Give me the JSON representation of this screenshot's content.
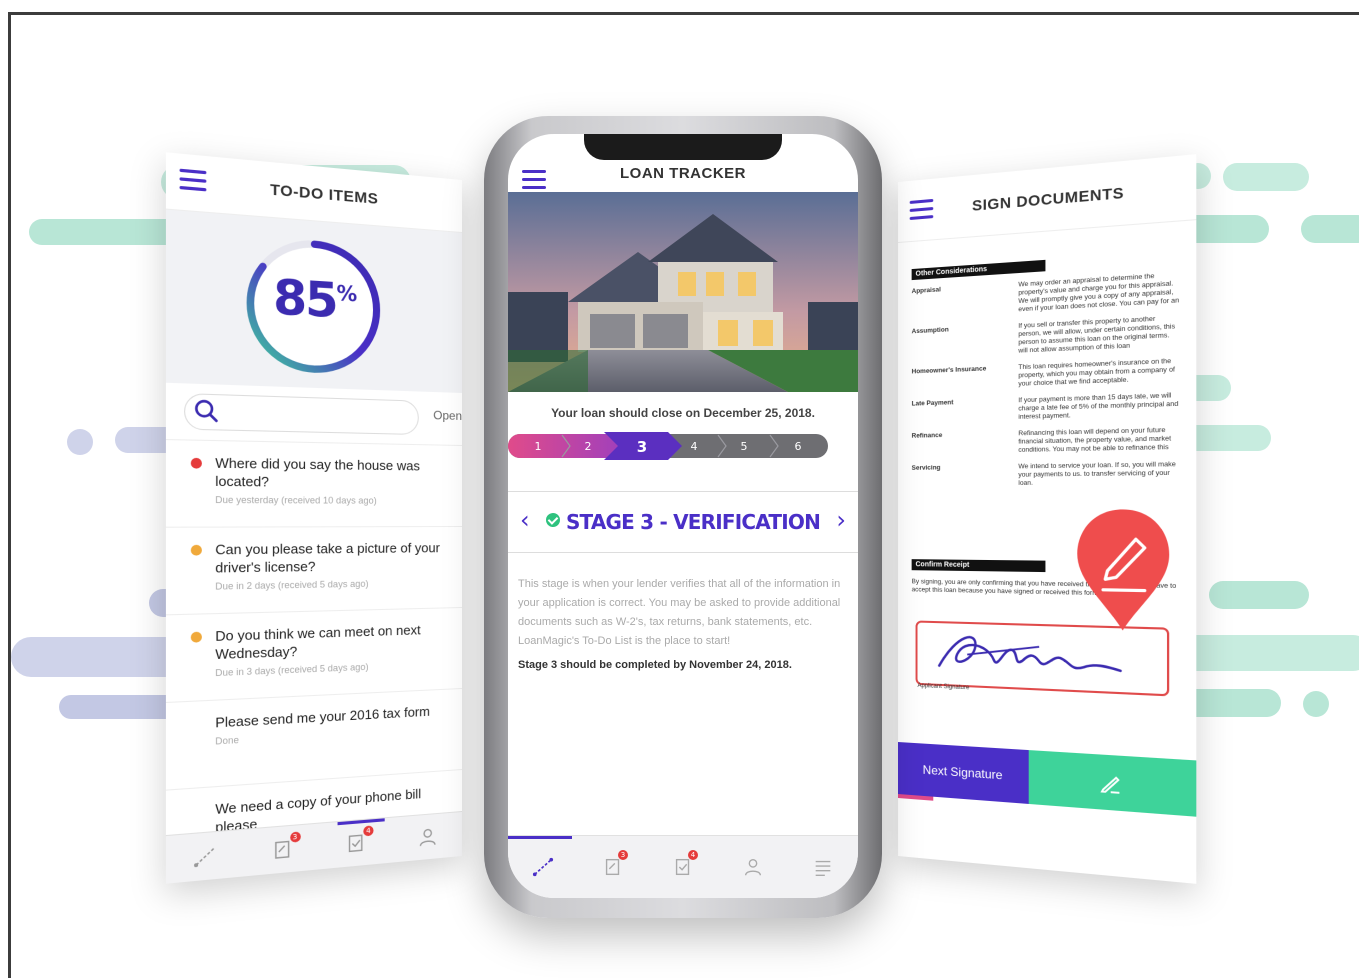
{
  "colors": {
    "accent": "#4a2fc7",
    "green": "#3ed39a",
    "red": "#e53b3b",
    "orange": "#f0a93b"
  },
  "todo_screen": {
    "title": "TO-DO ITEMS",
    "progress_pct": 85,
    "progress_value": "85",
    "progress_unit": "%",
    "search_placeholder": "",
    "tab_open": "Open",
    "items": [
      {
        "text": "Where did you say the house was located?",
        "sub": "Due yesterday (received 10 days ago)",
        "status": "red"
      },
      {
        "text": "Can you please take a picture of your driver's license?",
        "sub": "Due in 2 days (received 5 days ago)",
        "status": "orange"
      },
      {
        "text": "Do you think we can meet on next Wednesday?",
        "sub": "Due in 3 days (received 5 days ago)",
        "status": "orange"
      },
      {
        "text": "Please send me your 2016 tax form",
        "sub": "Done",
        "status": "none"
      },
      {
        "text": "We need a copy of your phone bill please",
        "sub": "",
        "status": "none"
      }
    ],
    "tabs": [
      {
        "icon": "tracker-icon",
        "badge": ""
      },
      {
        "icon": "documents-icon",
        "badge": "3"
      },
      {
        "icon": "todo-icon",
        "badge": "4"
      },
      {
        "icon": "profile-icon",
        "badge": ""
      }
    ]
  },
  "loan_screen": {
    "title": "LOAN TRACKER",
    "close_text": "Your loan should close on December 25, 2018.",
    "steps": [
      "1",
      "2",
      "3",
      "4",
      "5",
      "6"
    ],
    "current_step": 3,
    "stage_title": "STAGE 3 - VERIFICATION",
    "description": "This stage is when your lender verifies that all of the information in your application is correct. You may be asked to provide additional documents such as W-2's, tax returns, bank statements, etc. LoanMagic's To-Do List is the place to start!",
    "complete_by": "Stage 3 should be completed by November 24, 2018.",
    "tabs": [
      {
        "icon": "tracker-icon",
        "badge": ""
      },
      {
        "icon": "documents-icon",
        "badge": "3"
      },
      {
        "icon": "todo-icon",
        "badge": "4"
      },
      {
        "icon": "profile-icon",
        "badge": ""
      },
      {
        "icon": "list-icon",
        "badge": ""
      }
    ]
  },
  "sign_screen": {
    "title": "SIGN DOCUMENTS",
    "section_other": "Other Considerations",
    "rows": [
      {
        "k": "Appraisal",
        "v": "We may order an appraisal to determine the property's value and charge you for this appraisal. We will promptly give you a copy of any appraisal, even if your loan does not close. You can pay for an additional appraisal"
      },
      {
        "k": "Assumption",
        "v": "If you sell or transfer this property to another person, we will allow, under certain conditions, this person to assume this loan on the original terms. will not allow assumption of this loan"
      },
      {
        "k": "Homeowner's Insurance",
        "v": "This loan requires homeowner's insurance on the property, which you may obtain from a company of your choice that we find acceptable."
      },
      {
        "k": "Late Payment",
        "v": "If your payment is more than 15 days late, we will charge a late fee of 5% of the monthly principal and interest payment."
      },
      {
        "k": "Refinance",
        "v": "Refinancing this loan will depend on your future financial situation, the property value, and market conditions. You may not be able to refinance this loan."
      },
      {
        "k": "Servicing",
        "v": "We intend to service your loan. If so, you will make your payments to us. to transfer servicing of your loan."
      }
    ],
    "section_confirm": "Confirm Receipt",
    "confirm_text": "By signing, you are only confirming that you have received this form. You do not have to accept this loan because you have signed or received this form.",
    "applicant_label": "Applicant Signature",
    "next_signature": "Next Signature"
  }
}
